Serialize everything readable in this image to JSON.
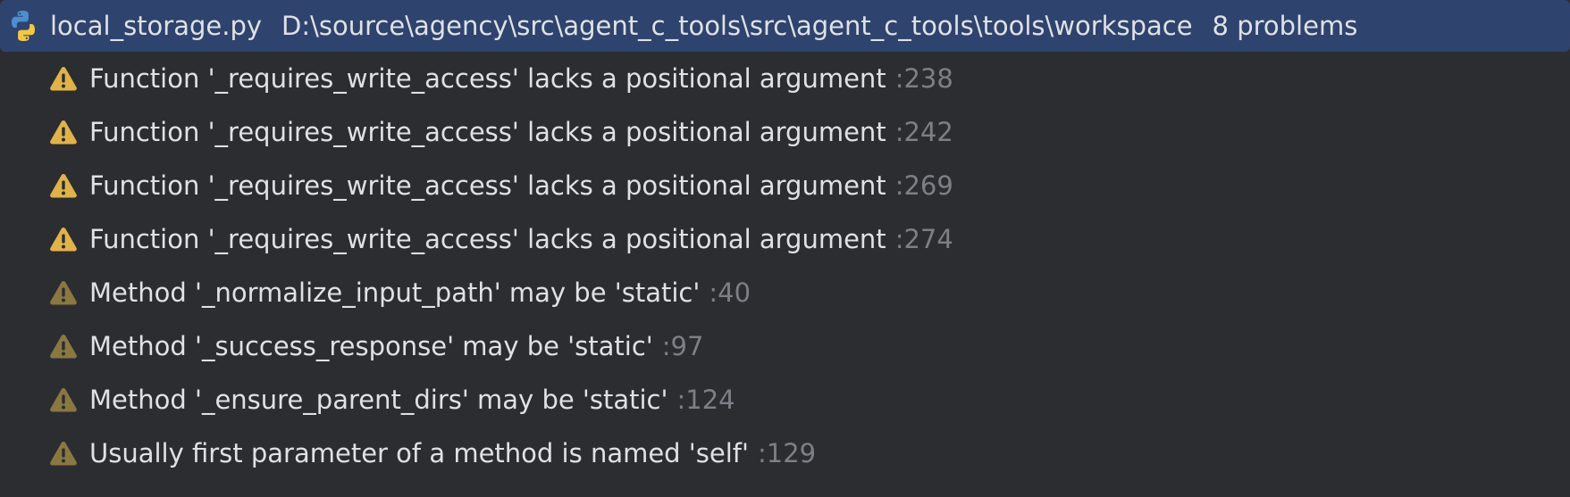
{
  "file": {
    "icon": "python-icon",
    "name": "local_storage.py",
    "path": "D:\\source\\agency\\src\\agent_c_tools\\src\\agent_c_tools\\tools\\workspace",
    "problem_count": "8 problems"
  },
  "colors": {
    "selection": "#2e436e",
    "background": "#2b2d30",
    "warning": "#e0b24a",
    "weak_warning": "#8a7842",
    "line_number": "#7c7f86"
  },
  "problems": [
    {
      "severity": "warning",
      "icon": "warning-icon",
      "message": "Function '_requires_write_access' lacks a positional argument",
      "line": ":238"
    },
    {
      "severity": "warning",
      "icon": "warning-icon",
      "message": "Function '_requires_write_access' lacks a positional argument",
      "line": ":242"
    },
    {
      "severity": "warning",
      "icon": "warning-icon",
      "message": "Function '_requires_write_access' lacks a positional argument",
      "line": ":269"
    },
    {
      "severity": "warning",
      "icon": "warning-icon",
      "message": "Function '_requires_write_access' lacks a positional argument",
      "line": ":274"
    },
    {
      "severity": "weak",
      "icon": "weak-warning-icon",
      "message": "Method '_normalize_input_path' may be 'static'",
      "line": ":40"
    },
    {
      "severity": "weak",
      "icon": "weak-warning-icon",
      "message": "Method '_success_response' may be 'static'",
      "line": ":97"
    },
    {
      "severity": "weak",
      "icon": "weak-warning-icon",
      "message": "Method '_ensure_parent_dirs' may be 'static'",
      "line": ":124"
    },
    {
      "severity": "weak",
      "icon": "weak-warning-icon",
      "message": "Usually first parameter of a method is named 'self'",
      "line": ":129"
    }
  ]
}
